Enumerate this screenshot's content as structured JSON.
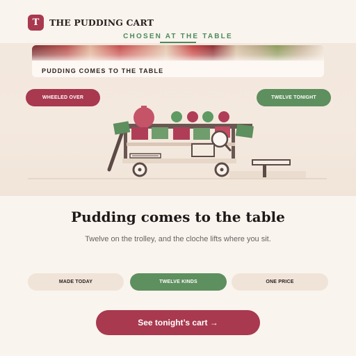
{
  "brand": {
    "logo_letter": "T",
    "name": "THE PUDDING CART"
  },
  "hero": {
    "kicker": "CHOSEN AT THE TABLE",
    "photo_caption": "PUDDING COMES TO THE TABLE",
    "tag_left": "WHEELED OVER",
    "tag_right": "TWELVE TONIGHT"
  },
  "main": {
    "title": "Pudding comes to the table",
    "subtitle": "Twelve on the trolley, and the cloche lifts where you sit."
  },
  "pills": [
    "MADE TODAY",
    "TWELVE KINDS",
    "ONE PRICE"
  ],
  "cta": {
    "label": "See tonight’s cart →"
  },
  "colors": {
    "accent": "#a8394f",
    "green": "#5e8f5e",
    "kicker_green": "#4c8a5b",
    "cream": "#f9f4ee",
    "sand": "#f0e4d9"
  },
  "icons": [
    "logo-mark",
    "pudding-cart-illustration",
    "cloche-icon",
    "magnifier-icon"
  ]
}
